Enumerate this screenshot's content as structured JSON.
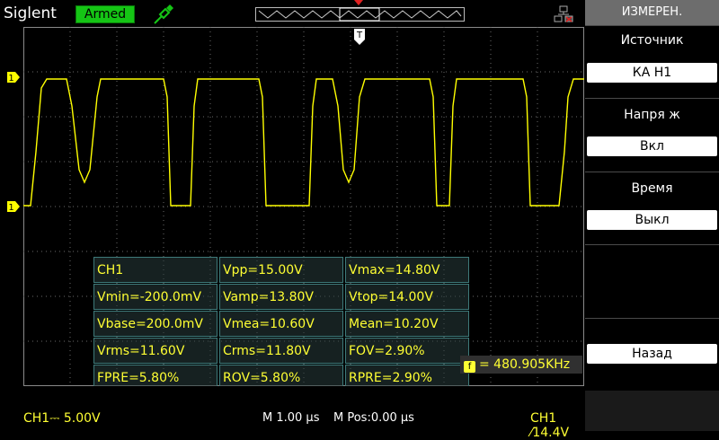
{
  "header": {
    "brand": "Siglent",
    "status": "Armed"
  },
  "side_menu": {
    "title": "ИЗМЕРЕН.",
    "source_label": "Источник",
    "source_value": "КА Н1",
    "voltage_label": "Напря ж",
    "voltage_value": "Вкл",
    "time_label": "Время",
    "time_value": "Выкл",
    "back_label": "Назад"
  },
  "channel_markers": {
    "ch1_level": "1",
    "ch1_ground": "1",
    "trigger_pos": "T"
  },
  "measurements": [
    [
      "CH1",
      "Vpp=15.00V",
      "Vmax=14.80V"
    ],
    [
      "Vmin=-200.0mV",
      "Vamp=13.80V",
      "Vtop=14.00V"
    ],
    [
      "Vbase=200.0mV",
      "Vmea=10.60V",
      "Mean=10.20V"
    ],
    [
      "Vrms=11.60V",
      "Crms=11.80V",
      "FOV=2.90%"
    ],
    [
      "FPRE=5.80%",
      "ROV=5.80%",
      "RPRE=2.90%"
    ]
  ],
  "frequency": {
    "icon": "f",
    "value": "= 480.905KHz"
  },
  "status_bar": {
    "ch1_scale": "CH1⎓ 5.00V",
    "timebase": "M 1.00 µs",
    "mpos": "M Pos:0.00 µs",
    "trigger": "CH1 ⁄14.4V"
  },
  "colors": {
    "trace": "#ffff00",
    "status_green": "#15c515",
    "grid": "#7a7a7a"
  }
}
